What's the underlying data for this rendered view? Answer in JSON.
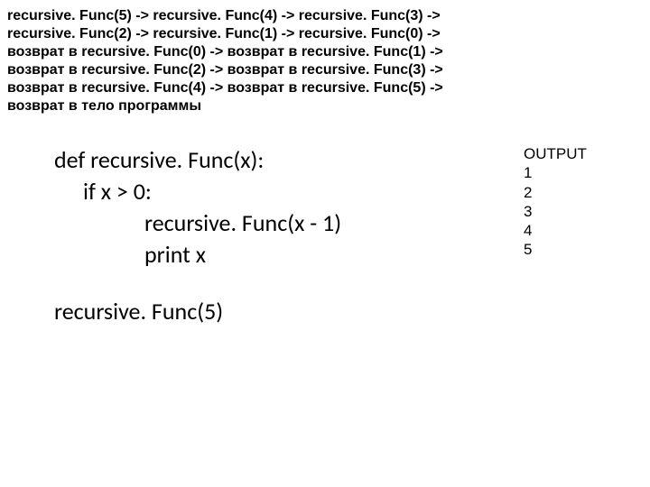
{
  "trace": {
    "l1": "recursive. Func(5) -> recursive. Func(4) -> recursive. Func(3) ->",
    "l2": "recursive. Func(2) -> recursive. Func(1) -> recursive. Func(0) ->",
    "l3": "возврат в recursive. Func(0) -> возврат в recursive. Func(1) ->",
    "l4": "возврат в recursive. Func(2) -> возврат в recursive. Func(3) ->",
    "l5": "возврат в recursive. Func(4) -> возврат в recursive. Func(5) ->",
    "l6": "возврат в тело программы"
  },
  "code": {
    "l1": "def recursive. Func(x):",
    "l2": "if x > 0:",
    "l3": "recursive. Func(x - 1)",
    "l4": "print x",
    "call": "recursive. Func(5)"
  },
  "output": {
    "title": "OUTPUT",
    "values": [
      "1",
      "2",
      "3",
      "4",
      "5"
    ]
  }
}
